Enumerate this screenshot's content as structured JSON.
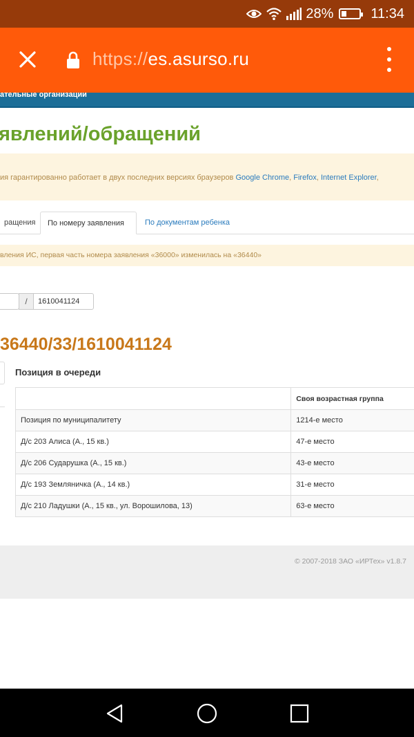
{
  "status_bar": {
    "battery_percent": "28%",
    "battery_level": 0.28,
    "time": "11:34",
    "icons": [
      "eye-icon",
      "wifi-icon",
      "signal-icon",
      "battery-icon"
    ]
  },
  "browser": {
    "url_scheme": "https://",
    "url_host": "es.asurso.ru",
    "close_icon": "close-icon",
    "lock_icon": "lock-icon",
    "menu_icon": "more-vert-icon"
  },
  "site_nav": {
    "partial_item": "ательные организации"
  },
  "page": {
    "title": "явлений/обращений",
    "notice_prefix": "ия гарантированно работает в двух последних версиях браузеров ",
    "notice_links": [
      "Google Chrome",
      "Firefox",
      "Internet Explorer"
    ],
    "notice_sep1": ", ",
    "notice_sep2": ", ",
    "notice_tail": ","
  },
  "tabs": [
    {
      "label": "ращения",
      "active": false
    },
    {
      "label": "По номеру заявления",
      "active": true
    },
    {
      "label": "По документам ребенка",
      "active": false
    }
  ],
  "warning": "вления ИС, первая часть номера заявления «36000» изменилась на «36440»",
  "search": {
    "separator": "/",
    "number_value": "1610041124"
  },
  "application_number": "36440/33/1610041124",
  "queue": {
    "title": "Позиция в очереди",
    "headers": [
      "",
      "Своя возрастная группа"
    ],
    "rows": [
      [
        "Позиция по муниципалитету",
        "1214-е место"
      ],
      [
        "Д/с 203 Алиса (А., 15 кв.)",
        "47-е место"
      ],
      [
        "Д/с 206 Сударушка (А., 15 кв.)",
        "43-е место"
      ],
      [
        "Д/с 193 Земляничка (А., 14 кв.)",
        "31-е место"
      ],
      [
        "Д/с 210 Ладушки (А., 15 кв., ул. Ворошилова, 13)",
        "63-е место"
      ]
    ]
  },
  "footer": {
    "copyright": "© 2007-2018 ЗАО «ИРТех» v1.8.7"
  },
  "nav_bar": {
    "icons": [
      "back-icon",
      "home-icon",
      "recents-icon"
    ]
  },
  "colors": {
    "status_bar": "#963a0a",
    "toolbar": "#ff5a0a",
    "title_green": "#6aa22b",
    "number_orange": "#c8781a",
    "link_blue": "#2a7bbd"
  }
}
